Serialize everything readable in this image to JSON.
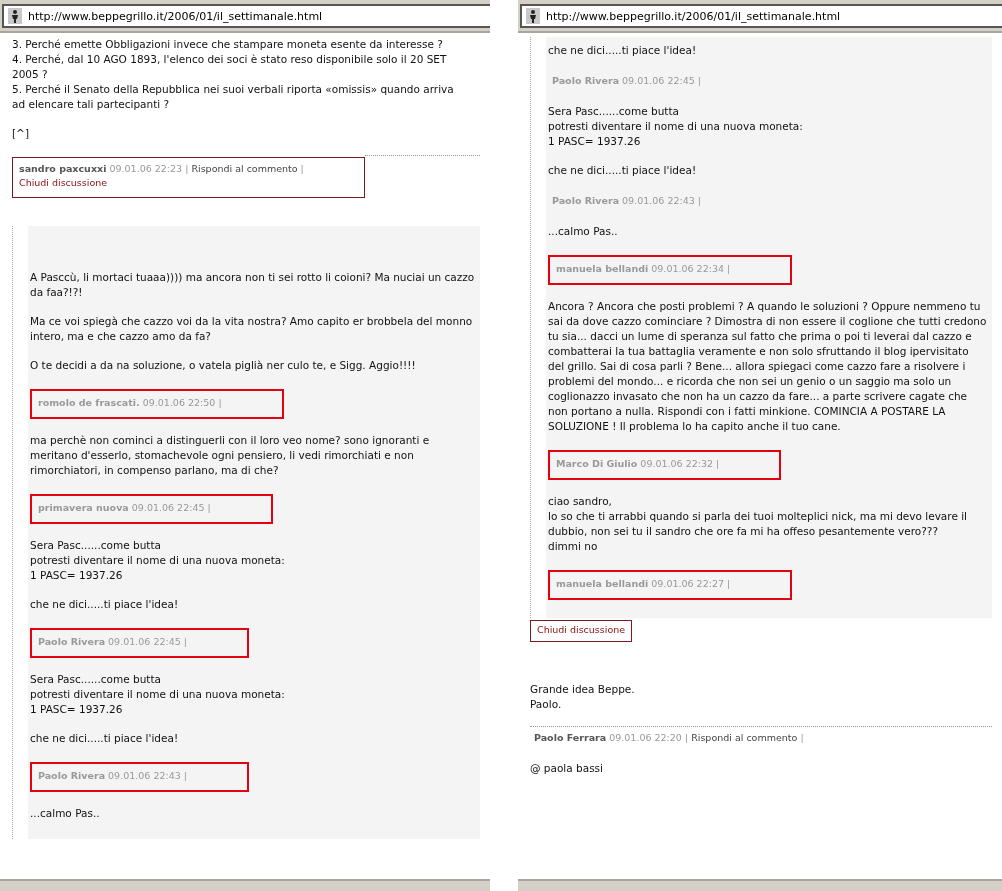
{
  "panels": [
    {
      "address": "http://www.beppegrillo.it/2006/01/il_settimanale.html",
      "items": [
        {
          "kind": "text",
          "paragraphs": [
            "3. Perché emette Obbligazioni invece che stampare moneta esente da interesse ?\n4. Perché, dal 10 AGO 1893, l'elenco dei soci è stato reso disponibile solo il 20 SET 2005 ?\n5. Perché il Senato della Repubblica nei suoi verbali riporta «omissis» quando arriva ad elencare tali partecipanti ?",
            "[^]"
          ]
        },
        {
          "kind": "meta",
          "framed": true,
          "heavy": false,
          "rule": true,
          "author": "sandro paxcuxxi",
          "time": "09.01.06 22:23",
          "sep": "|",
          "links": [
            {
              "kind": "reply",
              "label": "Rispondi al commento",
              "sep": "|"
            },
            {
              "kind": "close",
              "label": "Chiudi discussione"
            }
          ]
        },
        {
          "kind": "thread",
          "items": [
            {
              "kind": "text",
              "paragraphs": [
                "A Pasccù, li mortaci tuaaa)))) ma ancora non ti sei rotto li coioni? Ma nuciai un cazzo da faa?!?!",
                "Ma ce voi spiegà che cazzo voi da la vita nostra? Amo capito er brobbela del monno intero, ma e che cazzo amo da fa?",
                "O te decidi a da na soluzione, o vatela piglià ner culo te, e Sigg. Aggio!!!!"
              ]
            },
            {
              "kind": "meta",
              "framed": true,
              "heavy": true,
              "rule": false,
              "author": "romolo de frascati.",
              "time": "09.01.06 22:50",
              "sep": "|"
            },
            {
              "kind": "text",
              "paragraphs": [
                "ma perchè non cominci a distinguerli con il loro veo nome? sono ignoranti e meritano d'esserlo, stomachevole ogni pensiero, li vedi rimorchiati e non rimorchiatori, in compenso parlano, ma di che?"
              ]
            },
            {
              "kind": "meta",
              "framed": true,
              "heavy": true,
              "rule": false,
              "author": "primavera nuova",
              "time": "09.01.06 22:45",
              "sep": "|"
            },
            {
              "kind": "text",
              "paragraphs": [
                "Sera Pasc......come butta\npotresti diventare il nome di una nuova moneta:\n1 PASC= 1937.26",
                "che ne dici.....ti piace l'idea!"
              ]
            },
            {
              "kind": "meta",
              "framed": true,
              "heavy": true,
              "rule": false,
              "author": "Paolo Rivera",
              "time": "09.01.06 22:45",
              "sep": "|"
            },
            {
              "kind": "text",
              "paragraphs": [
                "Sera Pasc......come butta\npotresti diventare il nome di una nuova moneta:\n1 PASC= 1937.26",
                "che ne dici.....ti piace l'idea!"
              ]
            },
            {
              "kind": "meta",
              "framed": true,
              "heavy": true,
              "rule": false,
              "author": "Paolo Rivera",
              "time": "09.01.06 22:43",
              "sep": "|"
            },
            {
              "kind": "text",
              "paragraphs": [
                "...calmo Pas.."
              ]
            }
          ]
        }
      ]
    },
    {
      "address": "http://www.beppegrillo.it/2006/01/il_settimanale.html",
      "items": [
        {
          "kind": "thread",
          "items": [
            {
              "kind": "text",
              "paragraphs": [
                "che ne dici.....ti piace l'idea!"
              ]
            },
            {
              "kind": "meta",
              "framed": false,
              "rule": false,
              "author": "Paolo Rivera",
              "time": "09.01.06 22:45",
              "sep": "|"
            },
            {
              "kind": "text",
              "paragraphs": [
                "Sera Pasc......come butta\npotresti diventare il nome di una nuova moneta:\n1 PASC= 1937.26",
                "che ne dici.....ti piace l'idea!"
              ]
            },
            {
              "kind": "meta",
              "framed": false,
              "rule": false,
              "author": "Paolo Rivera",
              "time": "09.01.06 22:43",
              "sep": "|"
            },
            {
              "kind": "text",
              "paragraphs": [
                "...calmo Pas.."
              ]
            },
            {
              "kind": "meta",
              "framed": true,
              "heavy": true,
              "rule": false,
              "author": "manuela bellandi",
              "time": "09.01.06 22:34",
              "sep": "|"
            },
            {
              "kind": "text",
              "paragraphs": [
                "Ancora ? Ancora che posti problemi ? A quando le soluzioni ? Oppure nemmeno tu sai da dove cazzo cominciare ? Dimostra di non essere il coglione che tutti credono tu sia... dacci un lume di speranza sul fatto che prima o poi ti leverai dal cazzo e combatterai la tua battaglia veramente e non solo sfruttando il blog ipervisitato del grillo. Sai di cosa parli ? Bene... allora spiegaci come cazzo fare a risolvere i problemi del mondo... e ricorda che non sei un genio o un saggio ma solo un coglionazzo invasato che non ha un cazzo da fare... a parte scrivere cagate che non portano a nulla. Rispondi con i fatti minkione. COMINCIA A POSTARE LA SOLUZIONE ! Il problema lo ha capito anche il tuo cane."
              ]
            },
            {
              "kind": "meta",
              "framed": true,
              "heavy": true,
              "rule": false,
              "author": "Marco Di Giulio",
              "time": "09.01.06 22:32",
              "sep": "|"
            },
            {
              "kind": "text",
              "paragraphs": [
                "ciao sandro,\nlo so che ti arrabbi quando si parla dei tuoi molteplici nick, ma mi devo levare il dubbio, non sei tu il sandro che ore fa mi ha offeso pesantemente vero???\ndimmi no"
              ]
            },
            {
              "kind": "meta",
              "framed": true,
              "heavy": true,
              "rule": false,
              "author": "manuela bellandi",
              "time": "09.01.06 22:27",
              "sep": "|"
            }
          ]
        },
        {
          "kind": "link",
          "framed": true,
          "heavy": false,
          "label": "Chiudi discussione"
        },
        {
          "kind": "text",
          "paragraphs": [
            "Grande idea Beppe.\nPaolo."
          ]
        },
        {
          "kind": "meta",
          "framed": false,
          "rule": true,
          "author": "Paolo Ferrara",
          "time": "09.01.06 22:20",
          "sep": "|",
          "links": [
            {
              "kind": "reply",
              "label": "Rispondi al commento",
              "sep": "|"
            }
          ]
        },
        {
          "kind": "text",
          "paragraphs": [
            "@ paola bassi"
          ]
        }
      ]
    }
  ]
}
